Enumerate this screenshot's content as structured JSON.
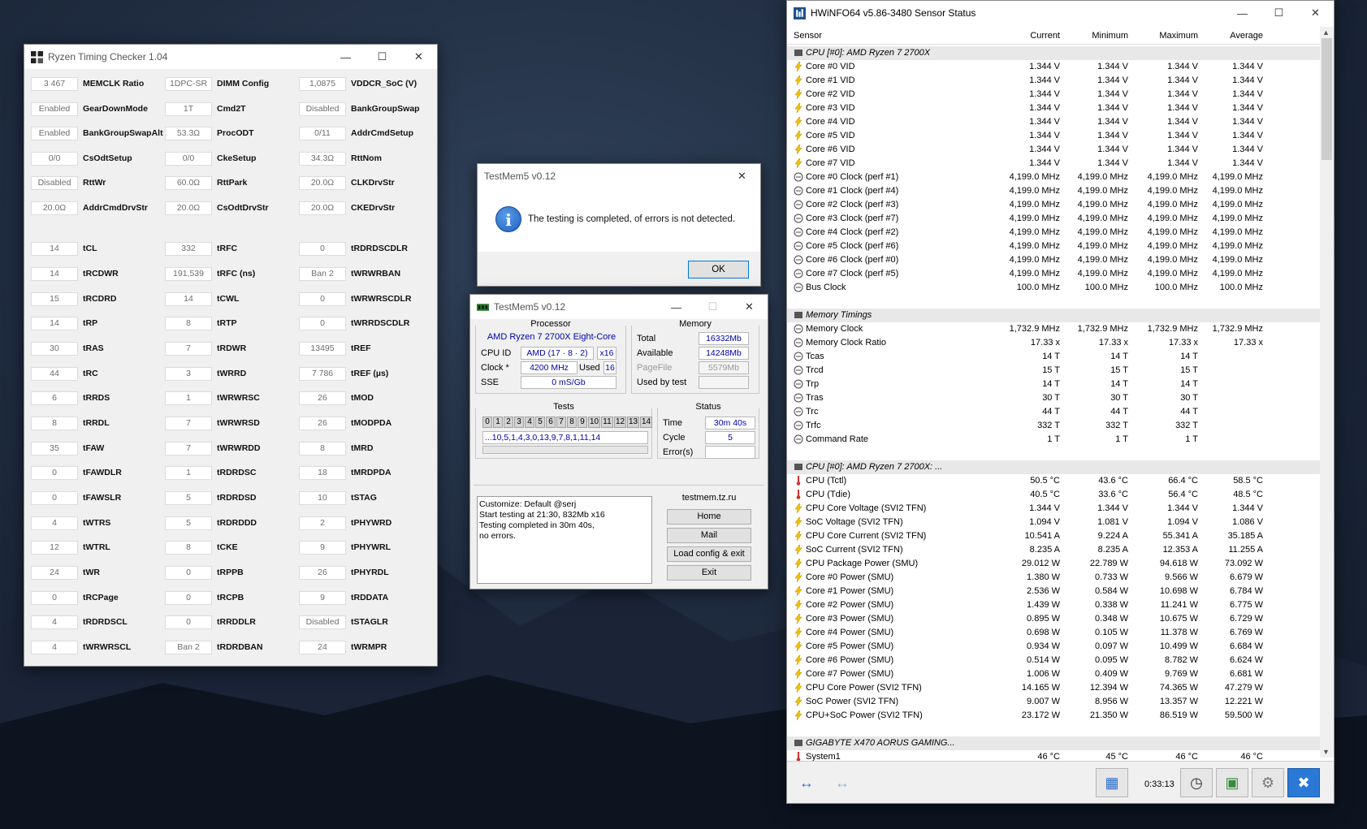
{
  "rtc": {
    "title": "Ryzen Timing Checker 1.04",
    "cols": [
      [
        [
          "3 467",
          "MEMCLK Ratio"
        ],
        [
          "Enabled",
          "GearDownMode"
        ],
        [
          "Enabled",
          "BankGroupSwapAlt"
        ],
        [
          "0/0",
          "CsOdtSetup"
        ],
        [
          "Disabled",
          "RttWr"
        ],
        [
          "20.0Ω",
          "AddrCmdDrvStr"
        ],
        null,
        [
          "14",
          "tCL"
        ],
        [
          "14",
          "tRCDWR"
        ],
        [
          "15",
          "tRCDRD"
        ],
        [
          "14",
          "tRP"
        ],
        [
          "30",
          "tRAS"
        ],
        [
          "44",
          "tRC"
        ],
        [
          "6",
          "tRRDS"
        ],
        [
          "8",
          "tRRDL"
        ],
        [
          "35",
          "tFAW"
        ],
        [
          "0",
          "tFAWDLR"
        ],
        [
          "0",
          "tFAWSLR"
        ],
        [
          "4",
          "tWTRS"
        ],
        [
          "12",
          "tWTRL"
        ],
        [
          "24",
          "tWR"
        ],
        [
          "0",
          "tRCPage"
        ],
        [
          "4",
          "tRDRDSCL"
        ],
        [
          "4",
          "tWRWRSCL"
        ]
      ],
      [
        [
          "1DPC-SR",
          "DIMM Config"
        ],
        [
          "1T",
          "Cmd2T"
        ],
        [
          "53.3Ω",
          "ProcODT"
        ],
        [
          "0/0",
          "CkeSetup"
        ],
        [
          "60.0Ω",
          "RttPark"
        ],
        [
          "20.0Ω",
          "CsOdtDrvStr"
        ],
        null,
        [
          "332",
          "tRFC"
        ],
        [
          "191,539",
          "tRFC (ns)"
        ],
        [
          "14",
          "tCWL"
        ],
        [
          "8",
          "tRTP"
        ],
        [
          "7",
          "tRDWR"
        ],
        [
          "3",
          "tWRRD"
        ],
        [
          "1",
          "tWRWRSC"
        ],
        [
          "7",
          "tWRWRSD"
        ],
        [
          "7",
          "tWRWRDD"
        ],
        [
          "1",
          "tRDRDSC"
        ],
        [
          "5",
          "tRDRDSD"
        ],
        [
          "5",
          "tRDRDDD"
        ],
        [
          "8",
          "tCKE"
        ],
        [
          "0",
          "tRPPB"
        ],
        [
          "0",
          "tRCPB"
        ],
        [
          "0",
          "tRRDDLR"
        ],
        [
          "Ban 2",
          "tRDRDBAN"
        ]
      ],
      [
        [
          "1,0875",
          "VDDCR_SoC (V)"
        ],
        [
          "Disabled",
          "BankGroupSwap"
        ],
        [
          "0/11",
          "AddrCmdSetup"
        ],
        [
          "34.3Ω",
          "RttNom"
        ],
        [
          "20.0Ω",
          "CLKDrvStr"
        ],
        [
          "20.0Ω",
          "CKEDrvStr"
        ],
        null,
        [
          "0",
          "tRDRDSCDLR"
        ],
        [
          "Ban 2",
          "tWRWRBAN"
        ],
        [
          "0",
          "tWRWRSCDLR"
        ],
        [
          "0",
          "tWRRDSCDLR"
        ],
        [
          "13495",
          "tREF"
        ],
        [
          "7 786",
          "tREF (µs)"
        ],
        [
          "26",
          "tMOD"
        ],
        [
          "26",
          "tMODPDA"
        ],
        [
          "8",
          "tMRD"
        ],
        [
          "18",
          "tMRDPDA"
        ],
        [
          "10",
          "tSTAG"
        ],
        [
          "2",
          "tPHYWRD"
        ],
        [
          "9",
          "tPHYWRL"
        ],
        [
          "26",
          "tPHYRDL"
        ],
        [
          "9",
          "tRDDATA"
        ],
        [
          "Disabled",
          "tSTAGLR"
        ],
        [
          "24",
          "tWRMPR"
        ]
      ]
    ]
  },
  "dialog": {
    "title": "TestMem5 v0.12",
    "message": "The testing is completed, of errors is not detected.",
    "ok": "OK"
  },
  "tm": {
    "title": "TestMem5 v0.12",
    "processor": {
      "label": "Processor",
      "name": "AMD Ryzen 7 2700X Eight-Core",
      "cpuid_label": "CPU ID",
      "cpuid": "AMD  (17 · 8 · 2)",
      "threads": "x16",
      "clock_label": "Clock *",
      "clock": "4200 MHz",
      "used_label": "Used",
      "used": "16",
      "sse_label": "SSE",
      "sse": "0 mS/Gb"
    },
    "memory": {
      "label": "Memory",
      "total_label": "Total",
      "total": "16332Mb",
      "avail_label": "Available",
      "avail": "14248Mb",
      "pagefile_label": "PageFile",
      "pagefile": "5579Mb",
      "usedby_label": "Used by test",
      "usedby": ""
    },
    "tests": {
      "label": "Tests",
      "nums": [
        "0",
        "1",
        "2",
        "3",
        "4",
        "5",
        "6",
        "7",
        "8",
        "9",
        "10",
        "11",
        "12",
        "13",
        "14"
      ],
      "sequence": "...10,5,1,4,3,0,13,9,7,8,1,11,14"
    },
    "status": {
      "label": "Status",
      "time_label": "Time",
      "time": "30m 40s",
      "cycle_label": "Cycle",
      "cycle": "5",
      "errors_label": "Error(s)",
      "errors": ""
    },
    "log": [
      "Customize: Default @serj",
      "Start testing at 21:30, 832Mb x16",
      "Testing completed in 30m 40s,",
      "no errors."
    ],
    "site": "testmem.tz.ru",
    "buttons": [
      "Home",
      "Mail",
      "Load config & exit",
      "Exit"
    ]
  },
  "hw": {
    "title": "HWiNFO64 v5.86-3480 Sensor Status",
    "headers": [
      "Sensor",
      "Current",
      "Minimum",
      "Maximum",
      "Average"
    ],
    "time": "0:33:13",
    "rows": [
      {
        "t": "sec",
        "n": "CPU [#0]: AMD Ryzen 7 2700X"
      },
      {
        "t": "v",
        "n": "Core #0 VID",
        "c": "1.344 V",
        "mi": "1.344 V",
        "ma": "1.344 V",
        "a": "1.344 V"
      },
      {
        "t": "v",
        "n": "Core #1 VID",
        "c": "1.344 V",
        "mi": "1.344 V",
        "ma": "1.344 V",
        "a": "1.344 V"
      },
      {
        "t": "v",
        "n": "Core #2 VID",
        "c": "1.344 V",
        "mi": "1.344 V",
        "ma": "1.344 V",
        "a": "1.344 V"
      },
      {
        "t": "v",
        "n": "Core #3 VID",
        "c": "1.344 V",
        "mi": "1.344 V",
        "ma": "1.344 V",
        "a": "1.344 V"
      },
      {
        "t": "v",
        "n": "Core #4 VID",
        "c": "1.344 V",
        "mi": "1.344 V",
        "ma": "1.344 V",
        "a": "1.344 V"
      },
      {
        "t": "v",
        "n": "Core #5 VID",
        "c": "1.344 V",
        "mi": "1.344 V",
        "ma": "1.344 V",
        "a": "1.344 V"
      },
      {
        "t": "v",
        "n": "Core #6 VID",
        "c": "1.344 V",
        "mi": "1.344 V",
        "ma": "1.344 V",
        "a": "1.344 V"
      },
      {
        "t": "v",
        "n": "Core #7 VID",
        "c": "1.344 V",
        "mi": "1.344 V",
        "ma": "1.344 V",
        "a": "1.344 V"
      },
      {
        "t": "c",
        "n": "Core #0 Clock (perf #1)",
        "c": "4,199.0 MHz",
        "mi": "4,199.0 MHz",
        "ma": "4,199.0 MHz",
        "a": "4,199.0 MHz"
      },
      {
        "t": "c",
        "n": "Core #1 Clock (perf #4)",
        "c": "4,199.0 MHz",
        "mi": "4,199.0 MHz",
        "ma": "4,199.0 MHz",
        "a": "4,199.0 MHz"
      },
      {
        "t": "c",
        "n": "Core #2 Clock (perf #3)",
        "c": "4,199.0 MHz",
        "mi": "4,199.0 MHz",
        "ma": "4,199.0 MHz",
        "a": "4,199.0 MHz"
      },
      {
        "t": "c",
        "n": "Core #3 Clock (perf #7)",
        "c": "4,199.0 MHz",
        "mi": "4,199.0 MHz",
        "ma": "4,199.0 MHz",
        "a": "4,199.0 MHz"
      },
      {
        "t": "c",
        "n": "Core #4 Clock (perf #2)",
        "c": "4,199.0 MHz",
        "mi": "4,199.0 MHz",
        "ma": "4,199.0 MHz",
        "a": "4,199.0 MHz"
      },
      {
        "t": "c",
        "n": "Core #5 Clock (perf #6)",
        "c": "4,199.0 MHz",
        "mi": "4,199.0 MHz",
        "ma": "4,199.0 MHz",
        "a": "4,199.0 MHz"
      },
      {
        "t": "c",
        "n": "Core #6 Clock (perf #0)",
        "c": "4,199.0 MHz",
        "mi": "4,199.0 MHz",
        "ma": "4,199.0 MHz",
        "a": "4,199.0 MHz"
      },
      {
        "t": "c",
        "n": "Core #7 Clock (perf #5)",
        "c": "4,199.0 MHz",
        "mi": "4,199.0 MHz",
        "ma": "4,199.0 MHz",
        "a": "4,199.0 MHz"
      },
      {
        "t": "c",
        "n": "Bus Clock",
        "c": "100.0 MHz",
        "mi": "100.0 MHz",
        "ma": "100.0 MHz",
        "a": "100.0 MHz"
      },
      {
        "t": "blank"
      },
      {
        "t": "sec",
        "n": "Memory Timings"
      },
      {
        "t": "c",
        "n": "Memory Clock",
        "c": "1,732.9 MHz",
        "mi": "1,732.9 MHz",
        "ma": "1,732.9 MHz",
        "a": "1,732.9 MHz"
      },
      {
        "t": "c",
        "n": "Memory Clock Ratio",
        "c": "17.33 x",
        "mi": "17.33 x",
        "ma": "17.33 x",
        "a": "17.33 x"
      },
      {
        "t": "c",
        "n": "Tcas",
        "c": "14 T",
        "mi": "14 T",
        "ma": "14 T",
        "a": ""
      },
      {
        "t": "c",
        "n": "Trcd",
        "c": "15 T",
        "mi": "15 T",
        "ma": "15 T",
        "a": ""
      },
      {
        "t": "c",
        "n": "Trp",
        "c": "14 T",
        "mi": "14 T",
        "ma": "14 T",
        "a": ""
      },
      {
        "t": "c",
        "n": "Tras",
        "c": "30 T",
        "mi": "30 T",
        "ma": "30 T",
        "a": ""
      },
      {
        "t": "c",
        "n": "Trc",
        "c": "44 T",
        "mi": "44 T",
        "ma": "44 T",
        "a": ""
      },
      {
        "t": "c",
        "n": "Trfc",
        "c": "332 T",
        "mi": "332 T",
        "ma": "332 T",
        "a": ""
      },
      {
        "t": "c",
        "n": "Command Rate",
        "c": "1 T",
        "mi": "1 T",
        "ma": "1 T",
        "a": ""
      },
      {
        "t": "blank"
      },
      {
        "t": "sec",
        "n": "CPU [#0]: AMD Ryzen 7 2700X: ..."
      },
      {
        "t": "t",
        "n": "CPU (Tctl)",
        "c": "50.5 °C",
        "mi": "43.6 °C",
        "ma": "66.4 °C",
        "a": "58.5 °C"
      },
      {
        "t": "t",
        "n": "CPU (Tdie)",
        "c": "40.5 °C",
        "mi": "33.6 °C",
        "ma": "56.4 °C",
        "a": "48.5 °C"
      },
      {
        "t": "v",
        "n": "CPU Core Voltage (SVI2 TFN)",
        "c": "1.344 V",
        "mi": "1.344 V",
        "ma": "1.344 V",
        "a": "1.344 V"
      },
      {
        "t": "v",
        "n": "SoC Voltage (SVI2 TFN)",
        "c": "1.094 V",
        "mi": "1.081 V",
        "ma": "1.094 V",
        "a": "1.086 V"
      },
      {
        "t": "v",
        "n": "CPU Core Current (SVI2 TFN)",
        "c": "10.541 A",
        "mi": "9.224 A",
        "ma": "55.341 A",
        "a": "35.185 A"
      },
      {
        "t": "v",
        "n": "SoC Current (SVI2 TFN)",
        "c": "8.235 A",
        "mi": "8.235 A",
        "ma": "12.353 A",
        "a": "11.255 A"
      },
      {
        "t": "v",
        "n": "CPU Package Power (SMU)",
        "c": "29.012 W",
        "mi": "22.789 W",
        "ma": "94.618 W",
        "a": "73.092 W"
      },
      {
        "t": "v",
        "n": "Core #0 Power (SMU)",
        "c": "1.380 W",
        "mi": "0.733 W",
        "ma": "9.566 W",
        "a": "6.679 W"
      },
      {
        "t": "v",
        "n": "Core #1 Power (SMU)",
        "c": "2.536 W",
        "mi": "0.584 W",
        "ma": "10.698 W",
        "a": "6.784 W"
      },
      {
        "t": "v",
        "n": "Core #2 Power (SMU)",
        "c": "1.439 W",
        "mi": "0.338 W",
        "ma": "11.241 W",
        "a": "6.775 W"
      },
      {
        "t": "v",
        "n": "Core #3 Power (SMU)",
        "c": "0.895 W",
        "mi": "0.348 W",
        "ma": "10.675 W",
        "a": "6.729 W"
      },
      {
        "t": "v",
        "n": "Core #4 Power (SMU)",
        "c": "0.698 W",
        "mi": "0.105 W",
        "ma": "11.378 W",
        "a": "6.769 W"
      },
      {
        "t": "v",
        "n": "Core #5 Power (SMU)",
        "c": "0.934 W",
        "mi": "0.097 W",
        "ma": "10.499 W",
        "a": "6.684 W"
      },
      {
        "t": "v",
        "n": "Core #6 Power (SMU)",
        "c": "0.514 W",
        "mi": "0.095 W",
        "ma": "8.782 W",
        "a": "6.624 W"
      },
      {
        "t": "v",
        "n": "Core #7 Power (SMU)",
        "c": "1.006 W",
        "mi": "0.409 W",
        "ma": "9.769 W",
        "a": "6.681 W"
      },
      {
        "t": "v",
        "n": "CPU Core Power (SVI2 TFN)",
        "c": "14.165 W",
        "mi": "12.394 W",
        "ma": "74.365 W",
        "a": "47.279 W"
      },
      {
        "t": "v",
        "n": "SoC Power (SVI2 TFN)",
        "c": "9.007 W",
        "mi": "8.956 W",
        "ma": "13.357 W",
        "a": "12.221 W"
      },
      {
        "t": "v",
        "n": "CPU+SoC Power (SVI2 TFN)",
        "c": "23.172 W",
        "mi": "21.350 W",
        "ma": "86.519 W",
        "a": "59.500 W"
      },
      {
        "t": "blank"
      },
      {
        "t": "sec",
        "n": "GIGABYTE X470 AORUS GAMING..."
      },
      {
        "t": "t",
        "n": "System1",
        "c": "46 °C",
        "mi": "45 °C",
        "ma": "46 °C",
        "a": "46 °C"
      }
    ]
  }
}
